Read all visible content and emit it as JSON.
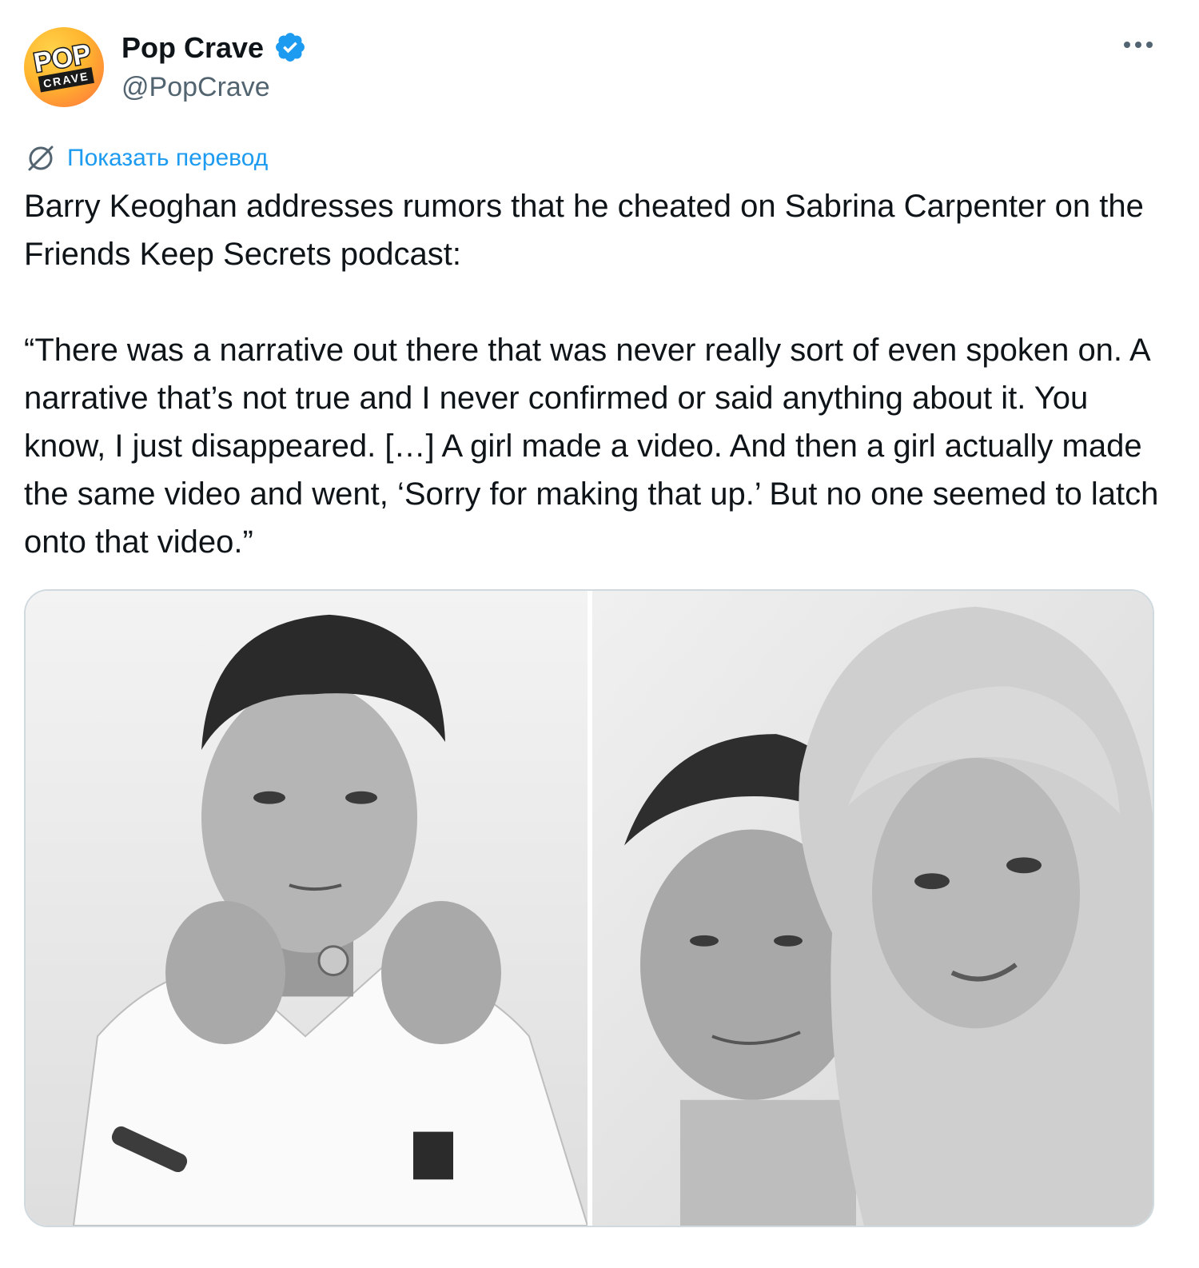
{
  "author": {
    "name": "Pop Crave",
    "handle": "@PopCrave",
    "verified": true,
    "avatar_logo_text": [
      "POP",
      "CRAVE"
    ]
  },
  "actions": {
    "more_icon": "more-horizontal-icon",
    "translate_icon": "translate-icon",
    "translate_label": "Показать перевод"
  },
  "tweet": {
    "paragraph_1": "Barry Keoghan addresses rumors that he cheated on Sabrina Carpenter on the Friends Keep Secrets podcast:",
    "paragraph_2": "“There was a narrative out there that was never really sort of even spoken on. A narrative that’s not true and I never confirmed or said anything about it. You know, I just disappeared. […] A girl made a video. And then a girl actually made the same video and went, ‘Sorry for making that up.’ But no one seemed to latch onto that video.”"
  },
  "media": {
    "count": 2,
    "photos": [
      "black-and-white-portrait",
      "black-and-white-couple-photo"
    ]
  },
  "colors": {
    "text": "#0f1419",
    "secondary": "#536471",
    "link": "#1d9bf0",
    "verified": "#1d9bf0",
    "border": "#cfd9de",
    "avatar_gradient": [
      "#ffd34a",
      "#ff6f3d"
    ]
  }
}
